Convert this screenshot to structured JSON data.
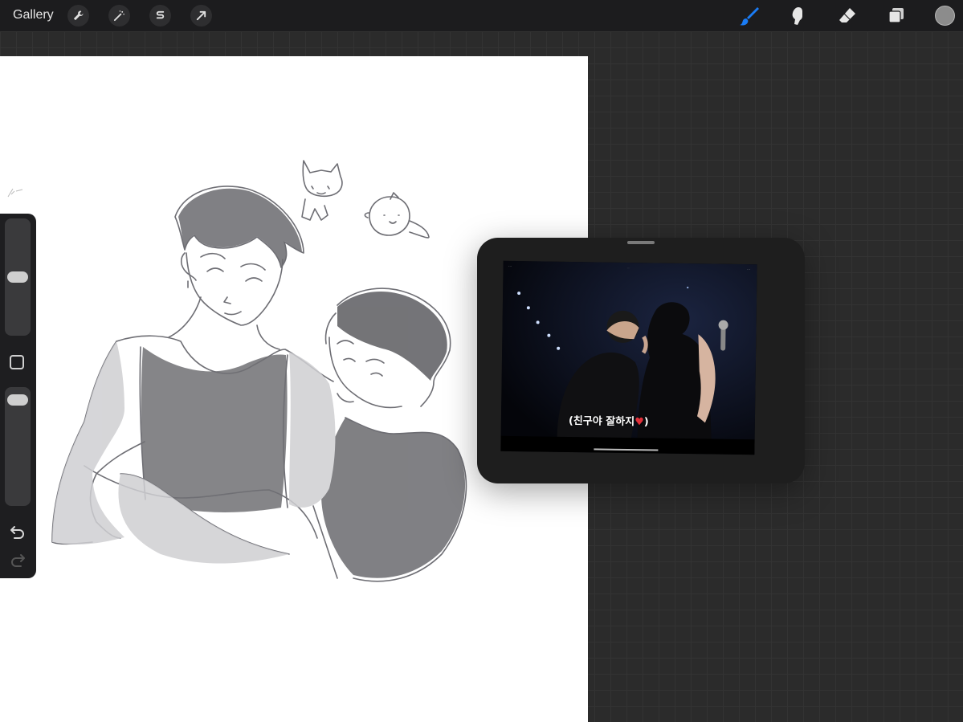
{
  "toolbar": {
    "gallery_label": "Gallery",
    "left_tools": [
      "wrench-icon",
      "magic-wand-icon",
      "selection-s-icon",
      "transform-arrow-icon"
    ],
    "right_tools": [
      "brush-icon",
      "smudge-icon",
      "eraser-icon",
      "layers-icon"
    ],
    "active_tool": "brush-icon",
    "active_color": "#8c8c8c",
    "accent_color": "#1a7cf5"
  },
  "sidebar": {
    "brush_size_level": 0.5,
    "opacity_level": 0.05,
    "modify_button": "square-icon",
    "undo": "undo-icon",
    "redo": "redo-icon"
  },
  "reference": {
    "subtitle_text": "(친구야 잘하지",
    "subtitle_end": ")",
    "heart": "♥"
  }
}
